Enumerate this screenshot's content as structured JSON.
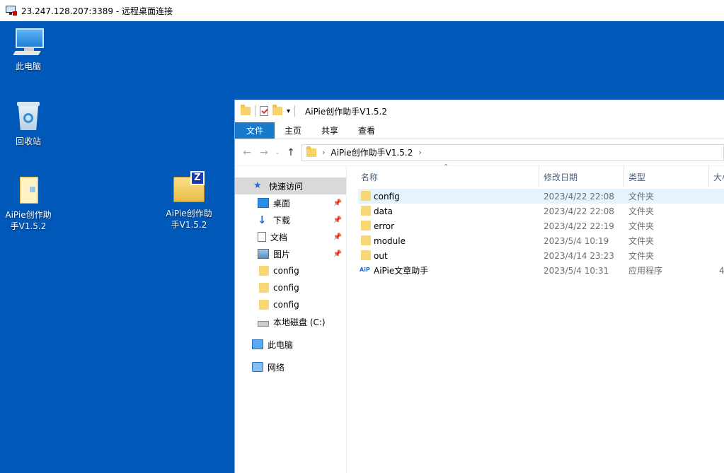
{
  "rdp": {
    "title": "23.247.128.207:3389 - 远程桌面连接"
  },
  "desktop": {
    "icons": [
      {
        "label_line1": "此电脑",
        "label_line2": ""
      },
      {
        "label_line1": "回收站",
        "label_line2": ""
      },
      {
        "label_line1": "AiPie创作助",
        "label_line2": "手V1.5.2"
      },
      {
        "label_line1": "AiPie创作助",
        "label_line2": "手V1.5.2"
      }
    ]
  },
  "explorer": {
    "title": "AiPie创作助手V1.5.2",
    "tabs": {
      "file": "文件",
      "home": "主页",
      "share": "共享",
      "view": "查看"
    },
    "address": {
      "path": "AiPie创作助手V1.5.2"
    },
    "nav": [
      {
        "label": "快速访问",
        "icon": "star-icon"
      },
      {
        "label": "桌面",
        "icon": "desktop-icon",
        "pinned": true
      },
      {
        "label": "下载",
        "icon": "download-icon",
        "pinned": true
      },
      {
        "label": "文档",
        "icon": "document-icon",
        "pinned": true
      },
      {
        "label": "图片",
        "icon": "picture-icon",
        "pinned": true
      },
      {
        "label": "config",
        "icon": "folder-icon"
      },
      {
        "label": "config",
        "icon": "folder-icon"
      },
      {
        "label": "config",
        "icon": "folder-icon"
      },
      {
        "label": "本地磁盘 (C:)",
        "icon": "drive-icon"
      },
      {
        "label": "此电脑",
        "icon": "computer-icon"
      },
      {
        "label": "网络",
        "icon": "network-icon"
      }
    ],
    "columns": {
      "name": "名称",
      "date": "修改日期",
      "type": "类型",
      "size": "大小"
    },
    "files": [
      {
        "name": "config",
        "date": "2023/4/22 22:08",
        "type": "文件夹",
        "size": ""
      },
      {
        "name": "data",
        "date": "2023/4/22 22:08",
        "type": "文件夹",
        "size": ""
      },
      {
        "name": "error",
        "date": "2023/4/22 22:19",
        "type": "文件夹",
        "size": ""
      },
      {
        "name": "module",
        "date": "2023/5/4 10:19",
        "type": "文件夹",
        "size": ""
      },
      {
        "name": "out",
        "date": "2023/4/14 23:23",
        "type": "文件夹",
        "size": ""
      },
      {
        "name": "AiPie文章助手",
        "date": "2023/5/4 10:31",
        "type": "应用程序",
        "size": "4",
        "app_badge": "AiP"
      }
    ]
  }
}
